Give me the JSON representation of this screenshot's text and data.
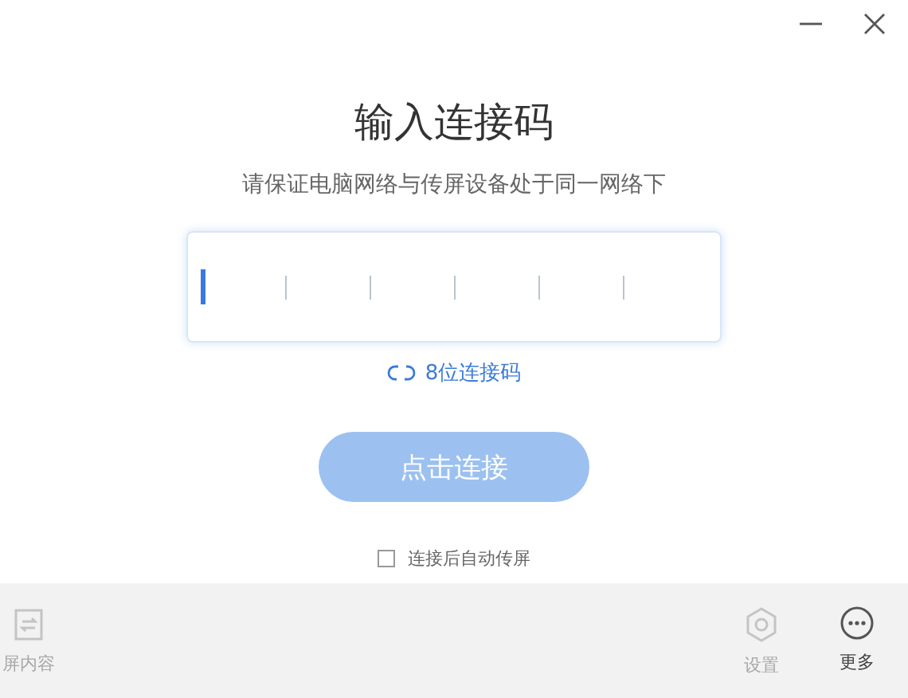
{
  "title": "输入连接码",
  "subtitle": "请保证电脑网络与传屏设备处于同一网络下",
  "code_field": {
    "slots": [
      {
        "selected": true
      },
      {
        "selected": false
      },
      {
        "selected": false
      },
      {
        "selected": false
      },
      {
        "selected": false
      },
      {
        "selected": false
      }
    ]
  },
  "switch_link": "8位连接码",
  "connect_button": {
    "label": "点击连接",
    "disabled": true
  },
  "auto_share": {
    "label": "连接后自动传屏",
    "checked": false
  },
  "bottom_bar": [
    {
      "kind": "share",
      "label": "屏内容",
      "disabled": true
    },
    {
      "kind": "settings",
      "label": "设置",
      "disabled": true
    },
    {
      "kind": "more",
      "label": "更多",
      "disabled": false
    }
  ]
}
